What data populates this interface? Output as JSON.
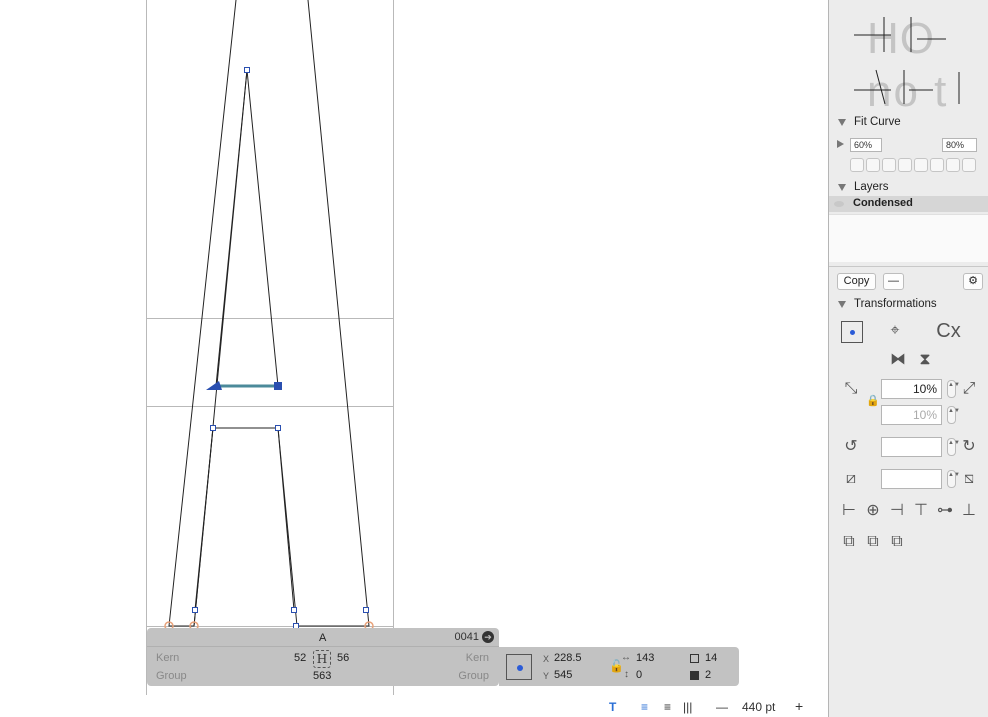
{
  "info_panel": {
    "glyph_name": "A",
    "unicode": "0041",
    "kern_label_left": "Kern",
    "kern_label_right": "Kern",
    "kern_left_value": "52",
    "kern_right_value": "56",
    "group_label_left": "Group",
    "group_label_right": "Group",
    "width_value": "563"
  },
  "selection_panel": {
    "x_label": "X",
    "x_value": "228.5",
    "y_label": "Y",
    "y_value": "545",
    "width_value": "143",
    "height_value": "0",
    "count_outline": "14",
    "count_filled": "2"
  },
  "bottom_toolbar": {
    "zoom_value": "440 pt",
    "minus": "—",
    "plus": "+"
  },
  "sidebar": {
    "preview_line1": "HO",
    "preview_line2": "no t",
    "fit_curve": {
      "title": "Fit Curve",
      "min": "60%",
      "max": "80%"
    },
    "layers": {
      "title": "Layers",
      "items": [
        "Condensed"
      ]
    },
    "copy_button": "Copy",
    "transformations": {
      "title": "Transformations",
      "scale_value": "10%",
      "scale_value_2": "10%",
      "rotate_value": "",
      "slant_value": ""
    }
  }
}
